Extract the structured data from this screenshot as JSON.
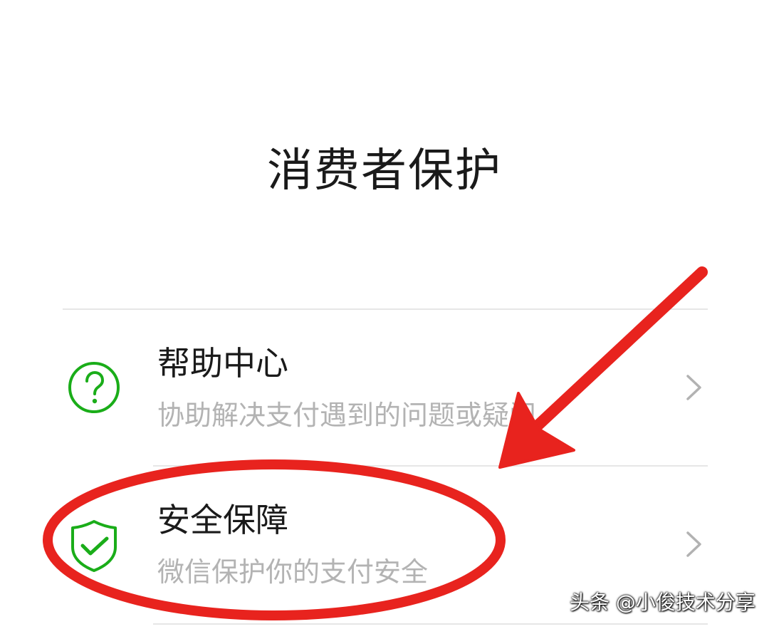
{
  "page": {
    "title": "消费者保护"
  },
  "menu": [
    {
      "title": "帮助中心",
      "desc": "协助解决支付遇到的问题或疑问",
      "icon": "question-circle-icon"
    },
    {
      "title": "安全保障",
      "desc": "微信保护你的支付安全",
      "icon": "shield-check-icon"
    }
  ],
  "annotation": {
    "color": "#e8231e",
    "highlight": "circle around 安全保障",
    "arrow": "pointing to 安全保障"
  },
  "watermark": {
    "text": "头条 @小俊技术分享"
  },
  "colors": {
    "accent": "#1aad19",
    "text": "#1a1a1a",
    "subtext": "#b3b3b3",
    "chevron": "#b2b2b2",
    "divider": "#e6e6e6"
  }
}
